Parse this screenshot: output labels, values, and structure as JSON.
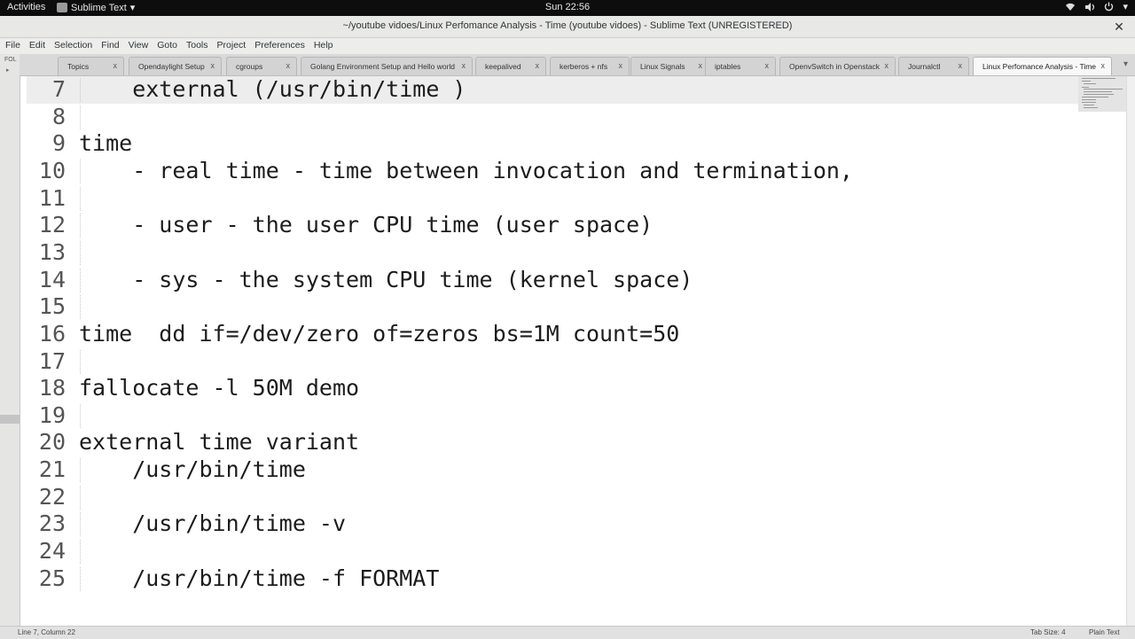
{
  "topbar": {
    "activities": "Activities",
    "app_name": "Sublime Text",
    "app_menu_arrow": "▾",
    "clock": "Sun 22:56",
    "tray_icons": [
      "network-icon",
      "volume-icon",
      "power-icon"
    ],
    "tray_arrow": "▾"
  },
  "window": {
    "title": "~/youtube vidoes/Linux Perfomance Analysis - Time (youtube vidoes) - Sublime Text (UNREGISTERED)",
    "close_glyph": "✕"
  },
  "menu": [
    "File",
    "Edit",
    "Selection",
    "Find",
    "View",
    "Goto",
    "Tools",
    "Project",
    "Preferences",
    "Help"
  ],
  "sidebar": {
    "label": "FOL"
  },
  "tabs": [
    {
      "label": "Topics",
      "close": "x"
    },
    {
      "label": "Opendaylight Setup",
      "close": "x"
    },
    {
      "label": "cgroups",
      "close": "x"
    },
    {
      "label": "Golang Environment Setup and Hello world",
      "close": "x"
    },
    {
      "label": "keepalived",
      "close": "x"
    },
    {
      "label": "kerberos + nfs",
      "close": "x"
    },
    {
      "label": "Linux Signals",
      "close": "x"
    },
    {
      "label": "iptables",
      "close": "x"
    },
    {
      "label": "OpenvSwitch in Openstack",
      "close": "x"
    },
    {
      "label": "Journalctl",
      "close": "x"
    },
    {
      "label": "Linux Perfomance Analysis - Time",
      "close": "x"
    }
  ],
  "tab_more": "▾",
  "editor": {
    "lines": [
      {
        "n": "7",
        "text": "    external (/usr/bin/time )"
      },
      {
        "n": "8",
        "text": ""
      },
      {
        "n": "9",
        "text": "time"
      },
      {
        "n": "10",
        "text": "    - real time - time between invocation and termination,"
      },
      {
        "n": "11",
        "text": ""
      },
      {
        "n": "12",
        "text": "    - user - the user CPU time (user space)"
      },
      {
        "n": "13",
        "text": ""
      },
      {
        "n": "14",
        "text": "    - sys - the system CPU time (kernel space)"
      },
      {
        "n": "15",
        "text": ""
      },
      {
        "n": "16",
        "text": "time  dd if=/dev/zero of=zeros bs=1M count=50"
      },
      {
        "n": "17",
        "text": ""
      },
      {
        "n": "18",
        "text": "fallocate -l 50M demo"
      },
      {
        "n": "19",
        "text": ""
      },
      {
        "n": "20",
        "text": "external time variant"
      },
      {
        "n": "21",
        "text": "    /usr/bin/time"
      },
      {
        "n": "22",
        "text": ""
      },
      {
        "n": "23",
        "text": "    /usr/bin/time -v"
      },
      {
        "n": "24",
        "text": ""
      },
      {
        "n": "25",
        "text": "    /usr/bin/time -f FORMAT"
      }
    ]
  },
  "status": {
    "position": "Line 7, Column 22",
    "tab_size": "Tab Size: 4",
    "syntax": "Plain Text"
  }
}
